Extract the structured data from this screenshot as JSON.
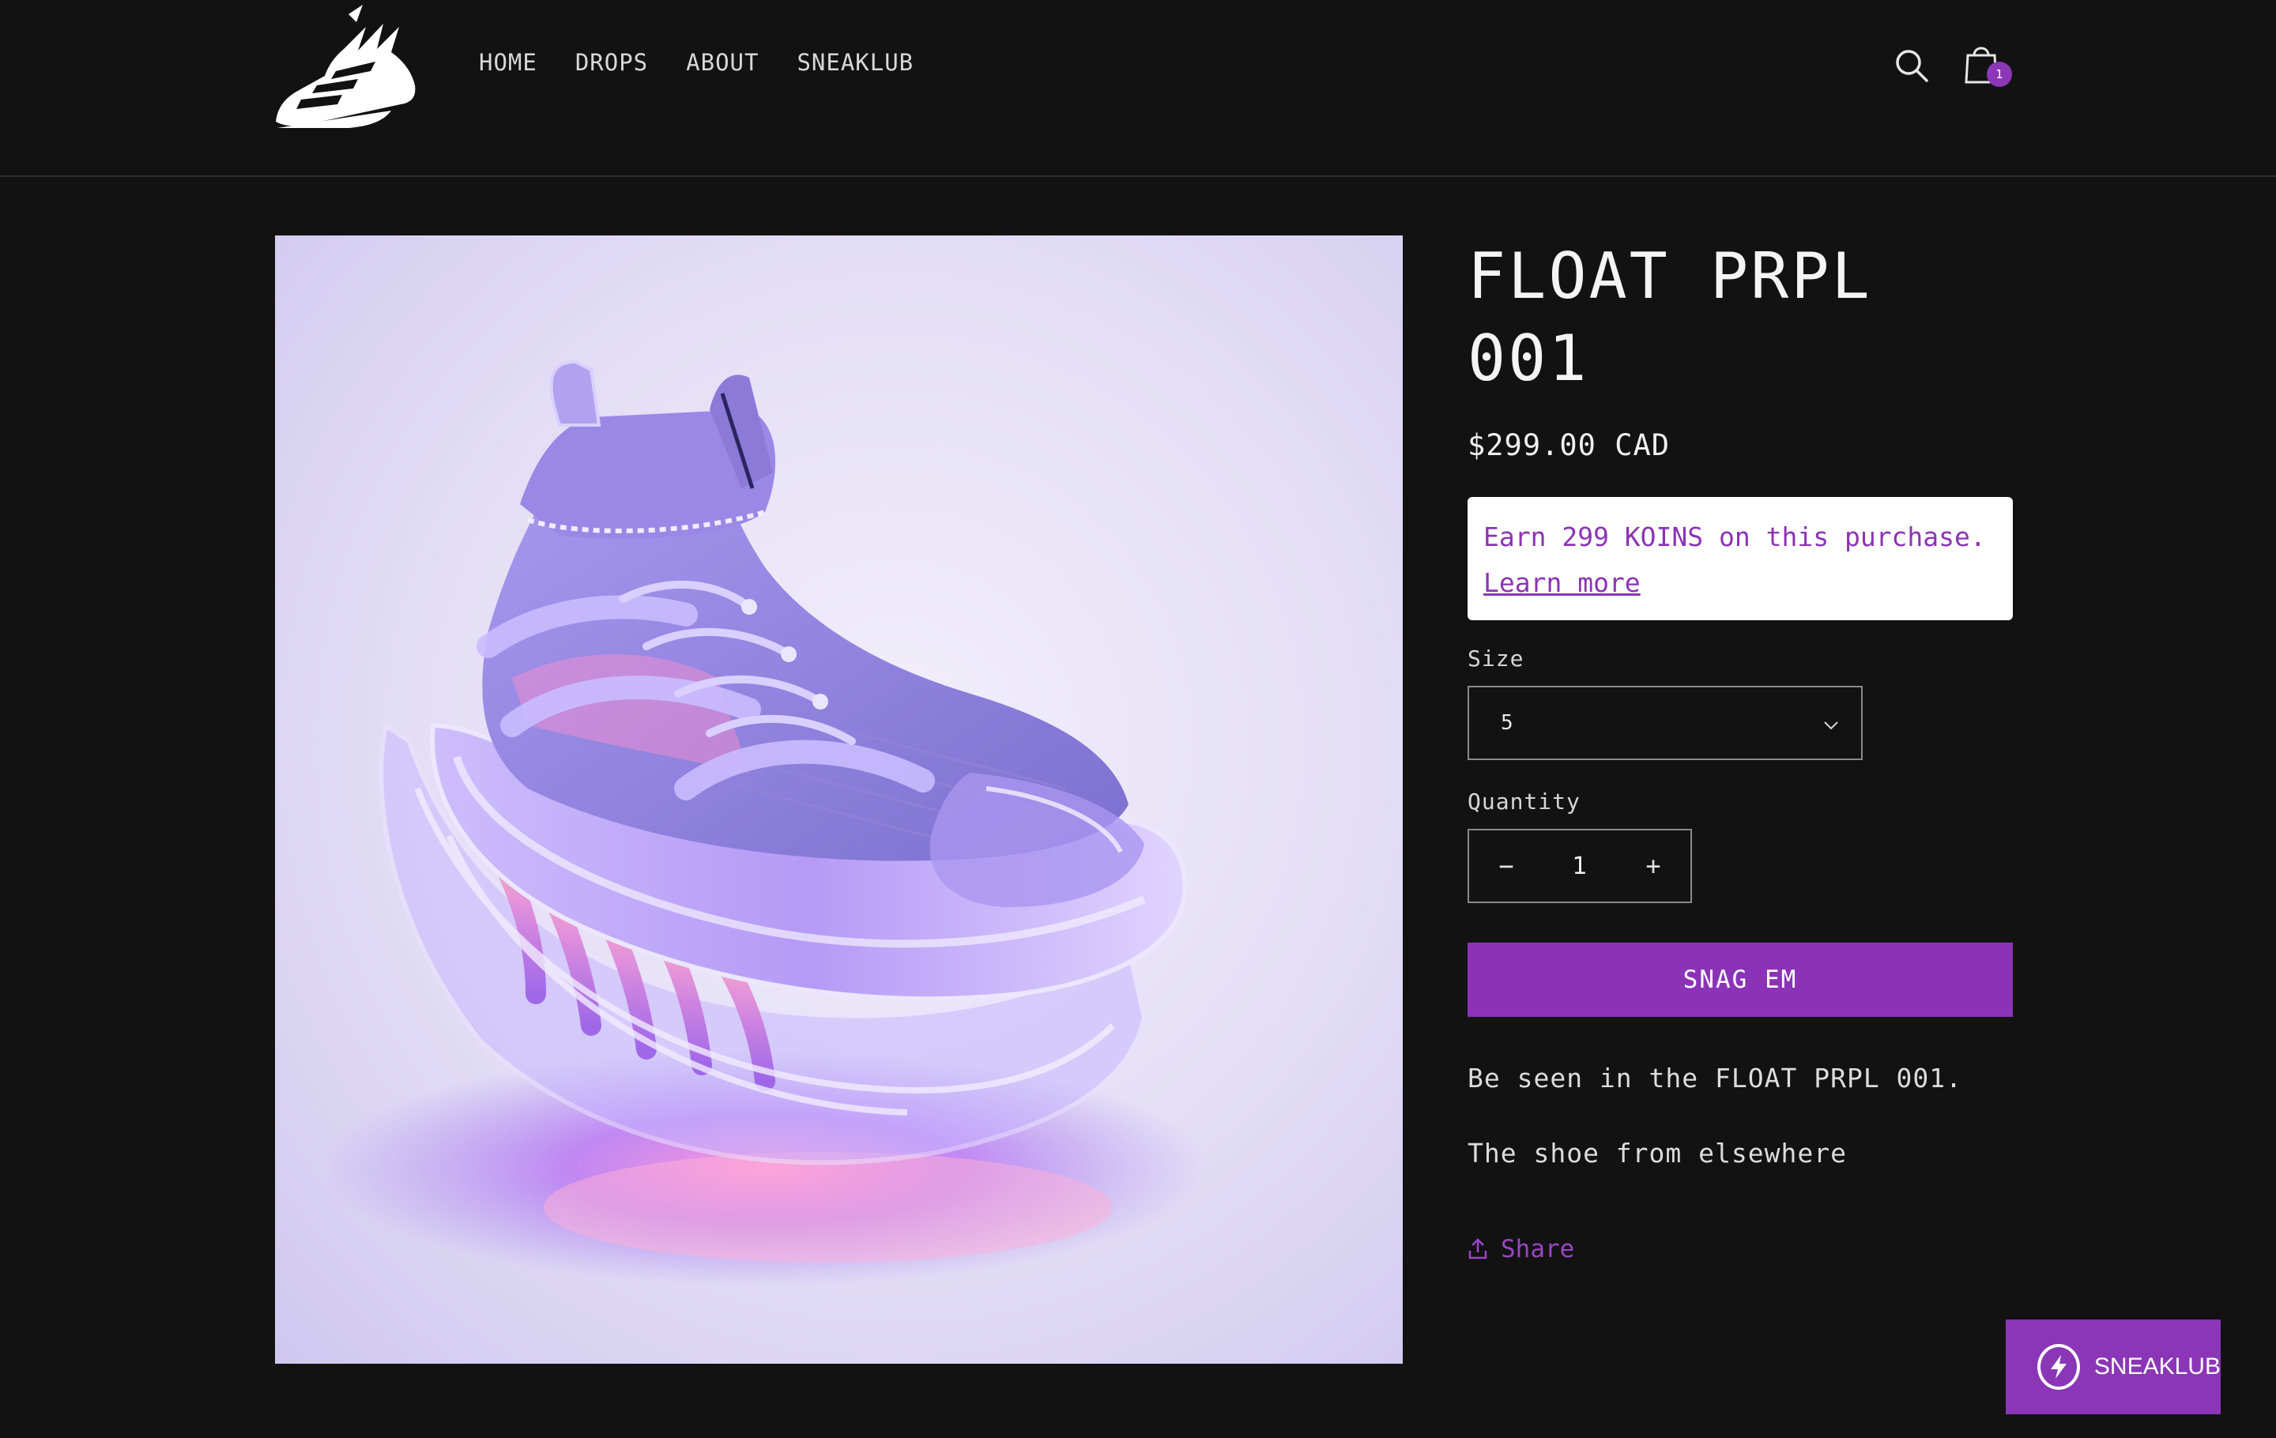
{
  "nav": {
    "items": [
      "HOME",
      "DROPS",
      "ABOUT",
      "SNEAKLUB"
    ]
  },
  "cart": {
    "count": "1"
  },
  "product": {
    "title": "FLOAT PRPL 001",
    "price": "$299.00 CAD",
    "koins_text": "Earn 299 KOINS on this purchase.",
    "koins_link": "Learn more",
    "size_label": "Size",
    "size_value": "5",
    "quantity_label": "Quantity",
    "quantity_value": "1",
    "quantity_minus": "−",
    "quantity_plus": "+",
    "add_button": "SNAG EM",
    "description": [
      "Be seen in the FLOAT PRPL 001.",
      "The shoe from elsewhere"
    ],
    "share_label": "Share"
  },
  "club_widget": {
    "label": "SNEAKLUB"
  },
  "colors": {
    "background": "#121212",
    "accent": "#8b33b6",
    "koins_text": "#8b34b4"
  },
  "icons": [
    "sneaker-logo",
    "search-icon",
    "cart-icon",
    "chevron-down-icon",
    "share-icon",
    "bolt-icon"
  ]
}
